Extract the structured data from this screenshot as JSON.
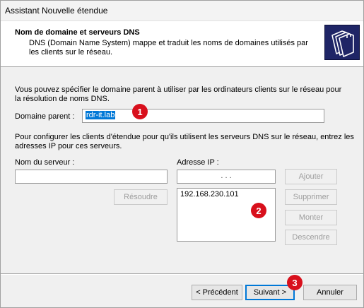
{
  "window": {
    "title": "Assistant Nouvelle étendue"
  },
  "header": {
    "title": "Nom de domaine et serveurs DNS",
    "description": "DNS (Domain Name System) mappe et traduit les noms de domaines utilisés par les clients sur le réseau.",
    "icon": "folders-icon"
  },
  "parent_domain": {
    "intro": "Vous pouvez spécifier le domaine parent à utiliser par les ordinateurs clients sur le réseau pour la résolution de noms DNS.",
    "label": "Domaine parent :",
    "value": "rdr-it.lab"
  },
  "dns_servers": {
    "intro": "Pour configurer les clients d'étendue pour qu'ils utilisent les serveurs DNS sur le réseau, entrez les adresses IP pour ces serveurs.",
    "server_name_label": "Nom du serveur :",
    "server_name_value": "",
    "ip_label": "Adresse IP :",
    "ip_input_value": ".        .        .",
    "resolve_button": "Résoudre",
    "ip_list": [
      "192.168.230.101"
    ],
    "buttons": {
      "add": "Ajouter",
      "remove": "Supprimer",
      "up": "Monter",
      "down": "Descendre"
    }
  },
  "footer": {
    "back": "< Précédent",
    "next": "Suivant >",
    "cancel": "Annuler"
  },
  "markers": [
    "1",
    "2",
    "3"
  ],
  "colors": {
    "marker": "#d8101c",
    "selection": "#0078d7",
    "header_icon_bg": "#1f2566"
  }
}
